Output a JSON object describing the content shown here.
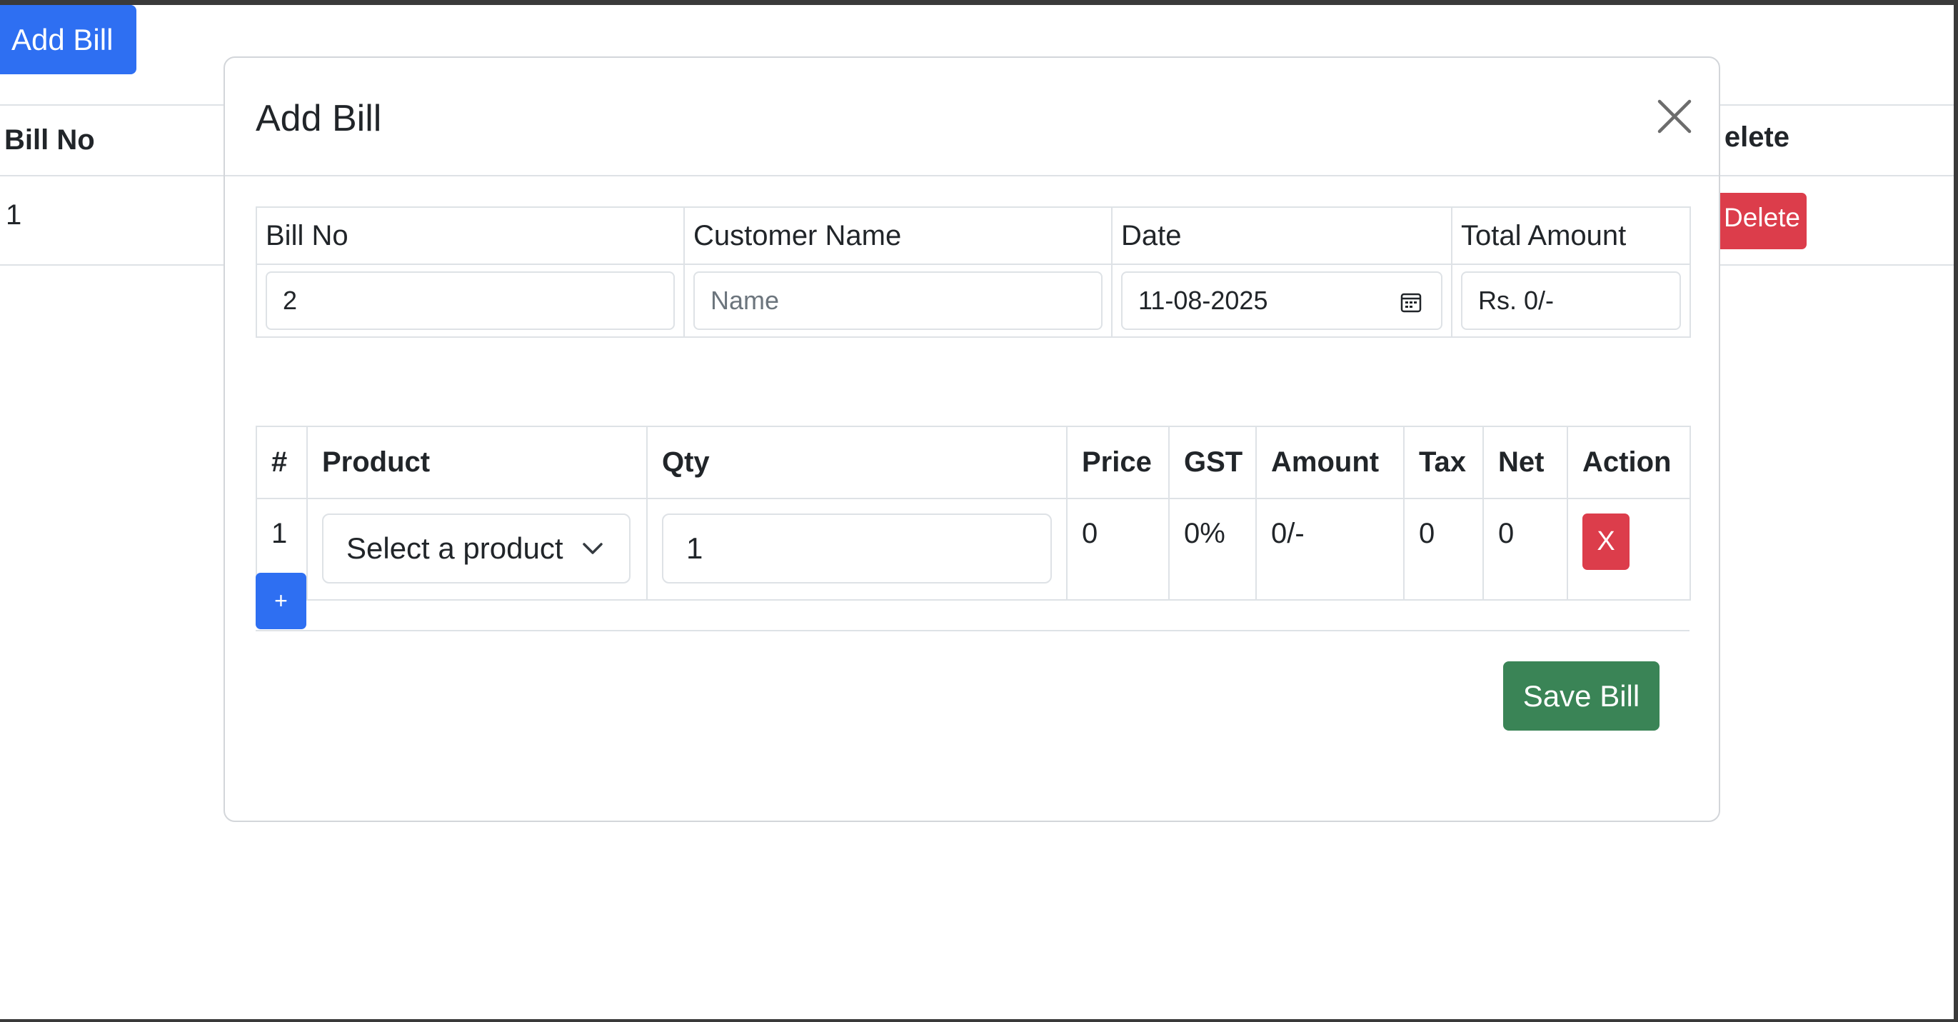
{
  "background": {
    "add_bill_label": "Add Bill",
    "table_headers": {
      "bill_no": "Bill No",
      "delete": "elete"
    },
    "row": {
      "bill_no": "1",
      "delete_label": "Delete"
    }
  },
  "modal": {
    "title": "Add Bill",
    "info_headers": [
      "Bill No",
      "Customer Name",
      "Date",
      "Total Amount"
    ],
    "bill_no_value": "2",
    "customer_name_placeholder": "Name",
    "date_value": "11-08-2025",
    "total_amount_value": "Rs. 0/-",
    "item_headers": [
      "#",
      "Product",
      "Qty",
      "Price",
      "GST",
      "Amount",
      "Tax",
      "Net",
      "Action"
    ],
    "items": [
      {
        "index": "1",
        "product": "Select a product",
        "qty": "1",
        "price": "0",
        "gst": "0%",
        "amount": "0/-",
        "tax": "0",
        "net": "0",
        "action_label": "X"
      }
    ],
    "add_row_label": "+",
    "save_label": "Save Bill"
  },
  "colors": {
    "primary": "#2e6ff2",
    "danger": "#dc3d4b",
    "success": "#3a8456"
  }
}
